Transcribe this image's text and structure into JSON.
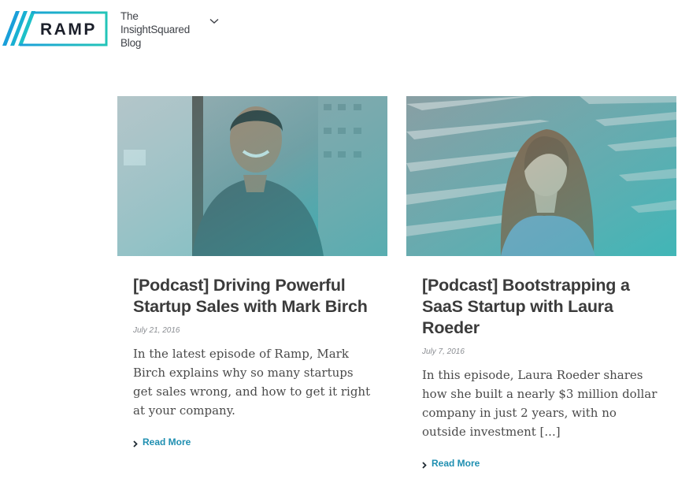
{
  "header": {
    "logo_text": "RAMP",
    "tagline_lines": [
      "The",
      "InsightSquared",
      "Blog"
    ],
    "menu_icon": "chevron-down-icon"
  },
  "colors": {
    "brand_teal": "#1fc0c4",
    "brand_blue": "#1aa0d8",
    "title_text": "#3b3b3b",
    "link": "#1f8fb1"
  },
  "posts": [
    {
      "title": "[Podcast] Driving Powerful Startup Sales with Mark Birch",
      "date": "July 21, 2016",
      "excerpt": "In the latest episode of Ramp, Mark Birch explains why so many startups get sales wrong, and how to get it right at your company.",
      "read_more": "Read More",
      "image": "portrait-smiling-man-photo"
    },
    {
      "title": "[Podcast] Bootstrapping a SaaS Startup with Laura Roeder",
      "date": "July 7, 2016",
      "excerpt": "In this episode, Laura Roeder shares how she built a nearly $3 million dollar company in just 2 years, with no outside investment [...]",
      "read_more": "Read More",
      "image": "portrait-woman-stairs-photo"
    }
  ]
}
